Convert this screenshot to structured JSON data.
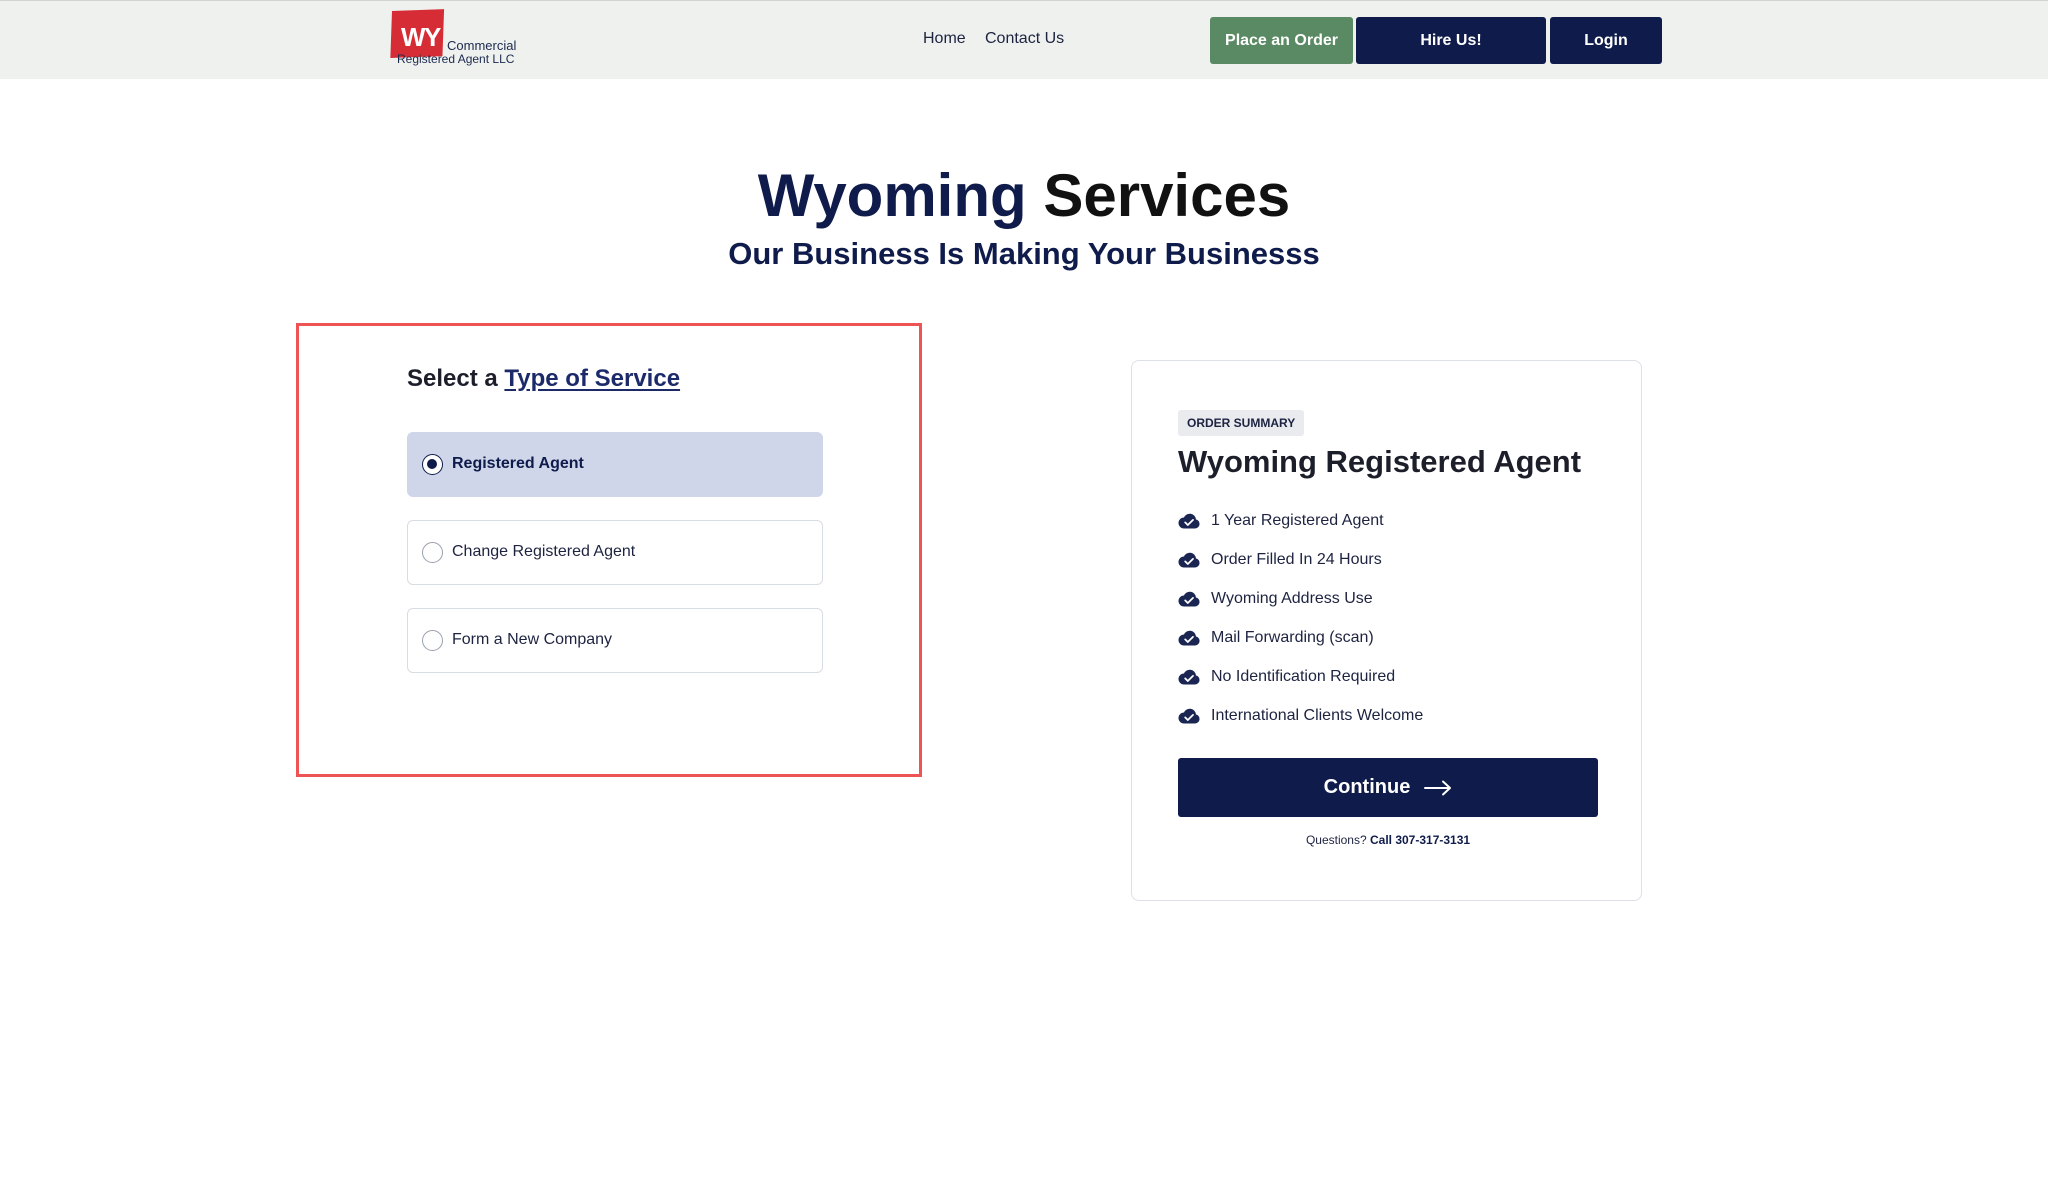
{
  "header": {
    "logo": {
      "badge": "WY",
      "line1": "Commercial",
      "line2": "Registered Agent LLC"
    },
    "nav": [
      {
        "label": "Home"
      },
      {
        "label": "Contact Us"
      }
    ],
    "buttons": {
      "place_order": "Place an Order",
      "hire_us": "Hire Us!",
      "login": "Login"
    }
  },
  "hero": {
    "title_part1": "Wyoming",
    "title_part2": "Services",
    "subtitle": "Our Business Is Making Your Businesss"
  },
  "service_selection": {
    "heading_prefix": "Select a",
    "heading_link": "Type of Service",
    "options": [
      {
        "label": "Registered Agent",
        "selected": true
      },
      {
        "label": "Change Registered Agent",
        "selected": false
      },
      {
        "label": "Form a New Company",
        "selected": false
      }
    ]
  },
  "order_summary": {
    "badge": "ORDER SUMMARY",
    "title": "Wyoming Registered Agent",
    "features": [
      {
        "label": "1 Year Registered Agent",
        "icon": "cloud-check-icon"
      },
      {
        "label": "Order Filled In 24 Hours",
        "icon": "cloud-check-icon"
      },
      {
        "label": "Wyoming Address Use",
        "icon": "cloud-check-icon"
      },
      {
        "label": "Mail Forwarding (scan)",
        "icon": "cloud-check-icon"
      },
      {
        "label": "No Identification Required",
        "icon": "cloud-check-icon"
      },
      {
        "label": "International Clients Welcome",
        "icon": "cloud-check-icon"
      }
    ],
    "continue_label": "Continue",
    "questions_label": "Questions?",
    "call_label": "Call 307-317-3131"
  },
  "colors": {
    "navy": "#0f1b4a",
    "green": "#5a8a63",
    "logo_red": "#d62c35",
    "highlight_border": "#ef5455",
    "selected_option_bg": "#cfd6ea",
    "header_bg": "#eef1ee"
  }
}
